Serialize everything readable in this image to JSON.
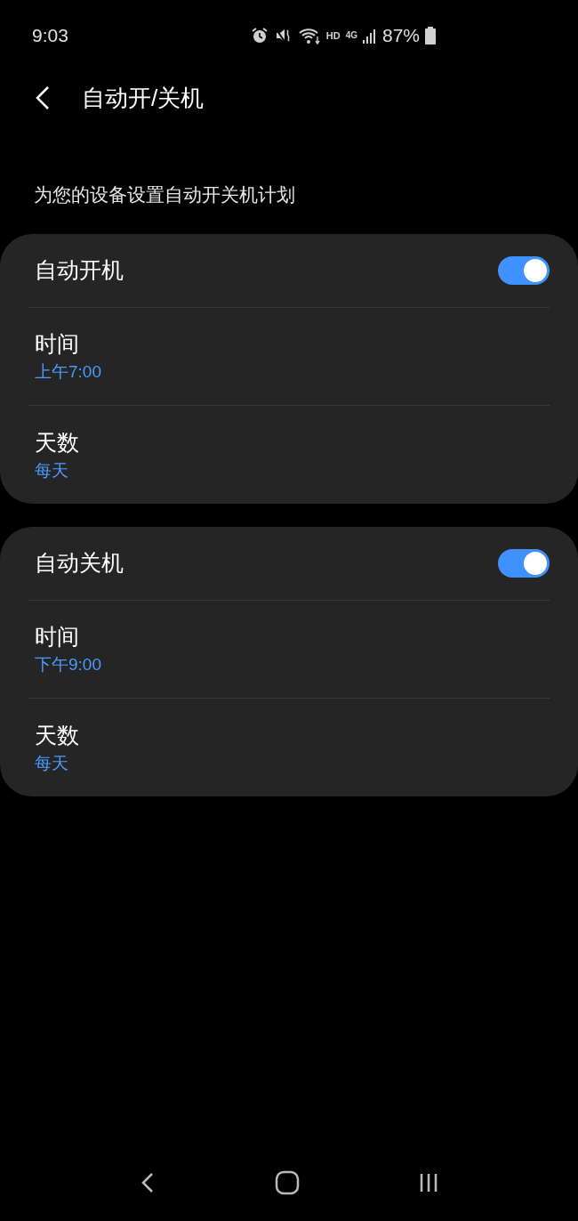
{
  "status_bar": {
    "time": "9:03",
    "badges": [
      "HD",
      "4G"
    ],
    "battery": "87%"
  },
  "header": {
    "title": "自动开/关机"
  },
  "description": "为您的设备设置自动开关机计划",
  "groups": [
    {
      "title": "自动开机",
      "on": true,
      "rows": [
        {
          "label": "时间",
          "value": "上午7:00"
        },
        {
          "label": "天数",
          "value": "每天"
        }
      ]
    },
    {
      "title": "自动关机",
      "on": true,
      "rows": [
        {
          "label": "时间",
          "value": "下午9:00"
        },
        {
          "label": "天数",
          "value": "每天"
        }
      ]
    }
  ]
}
